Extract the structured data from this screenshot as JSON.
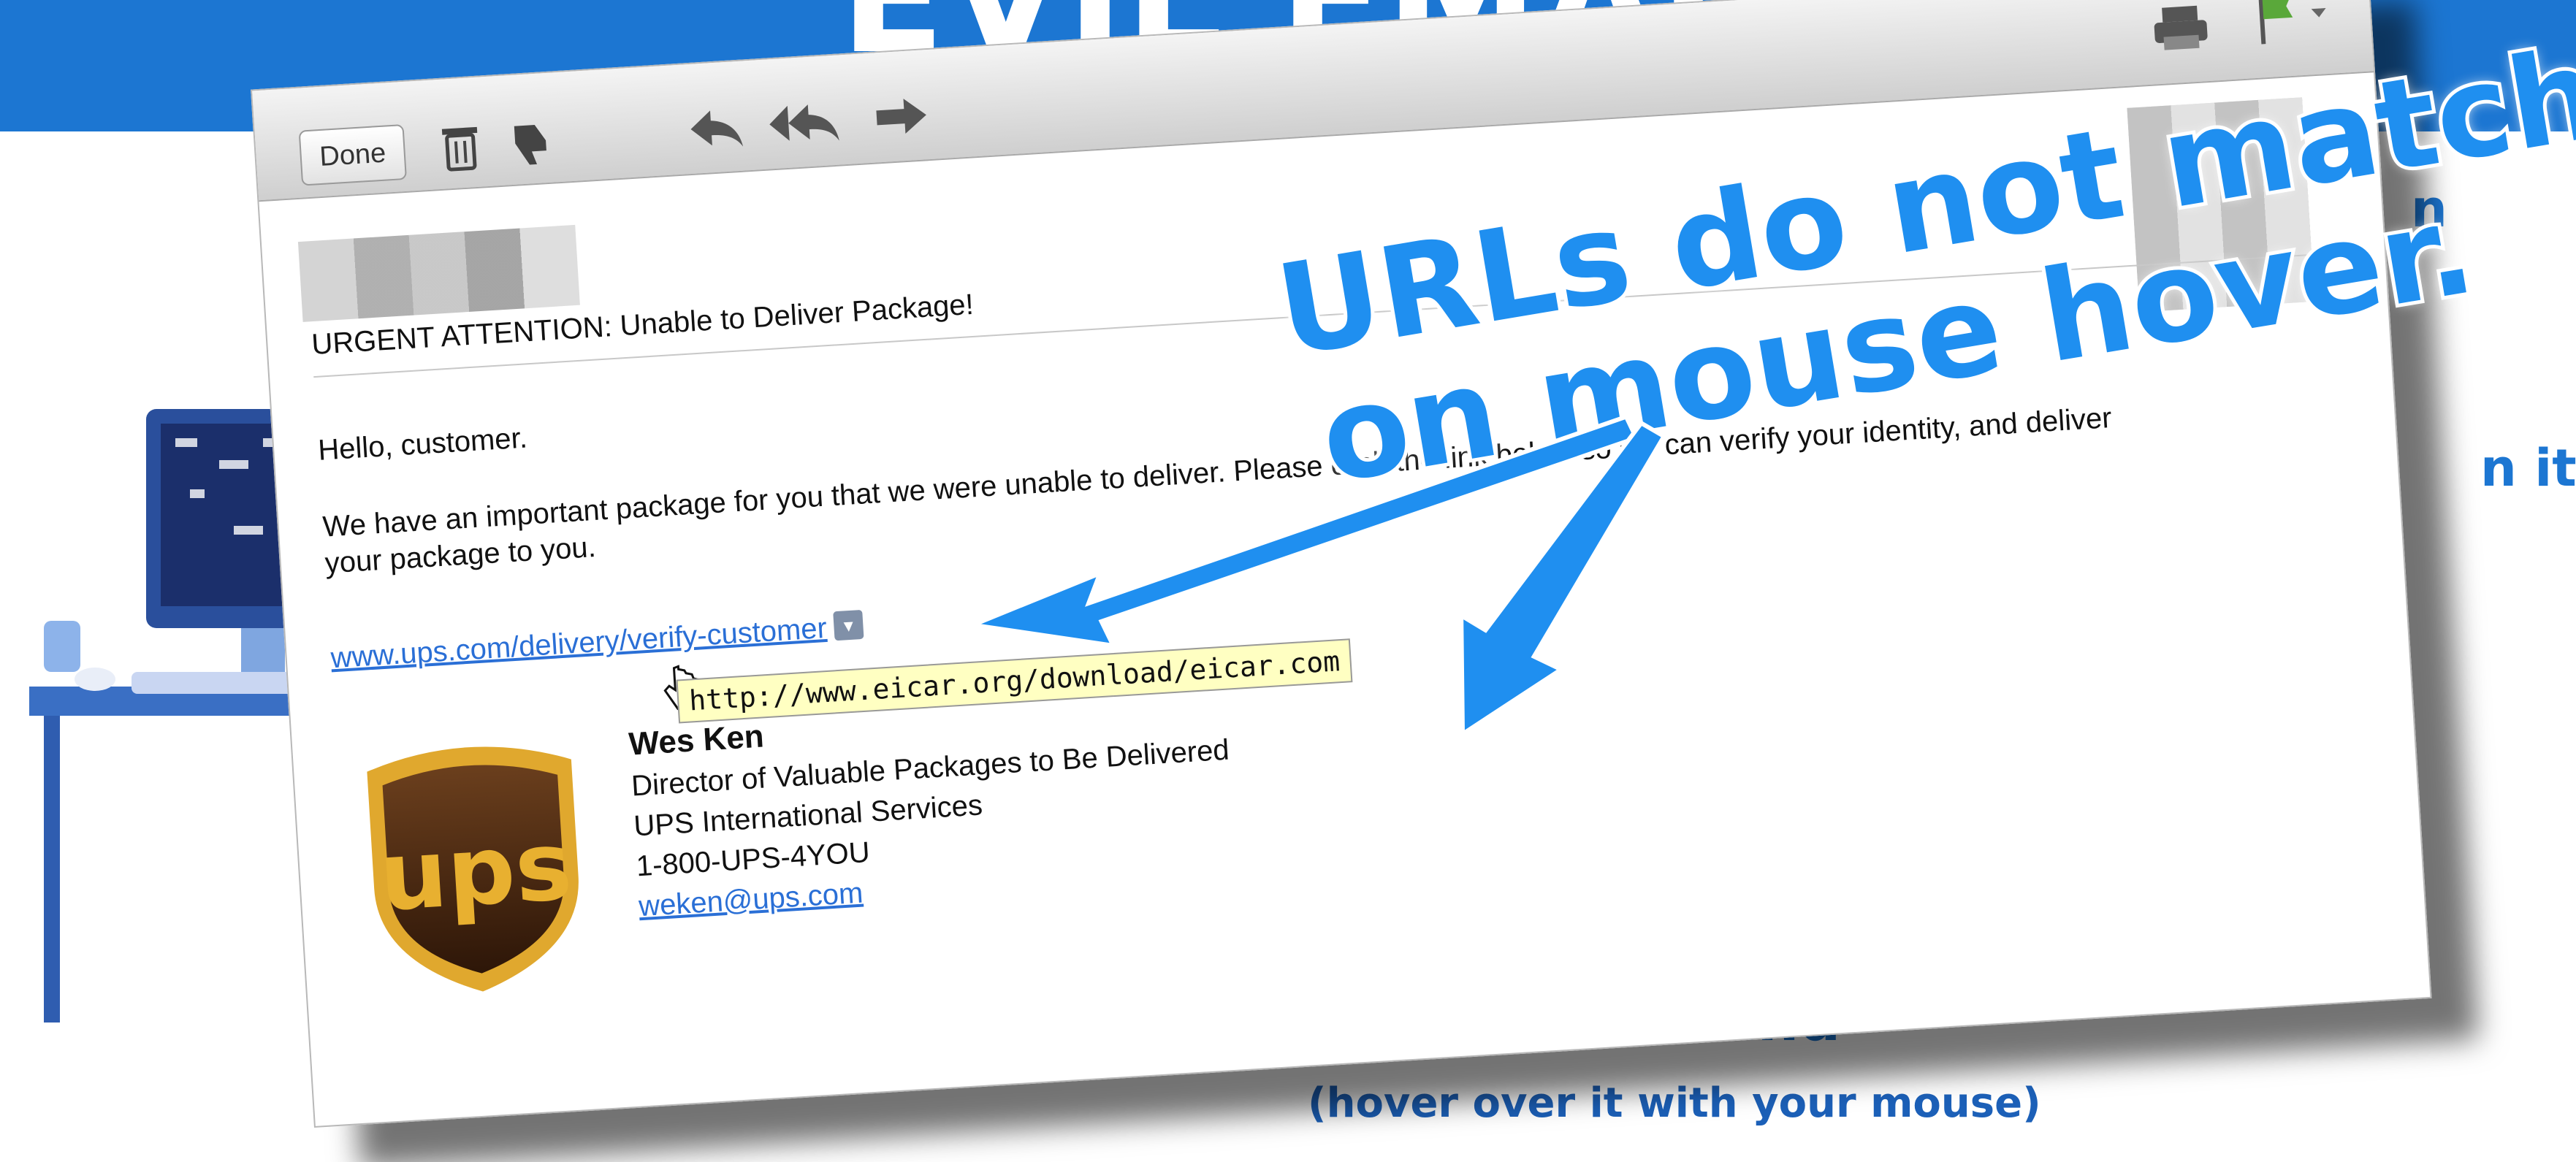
{
  "banner": {
    "title": "EVIL EMAIL"
  },
  "side_fragments": {
    "right_top": "n",
    "right_middle": "n it"
  },
  "footer": {
    "peek_text": "around",
    "hover_hint": "(hover over it with your mouse)"
  },
  "email": {
    "toolbar": {
      "done_label": "Done",
      "icons": [
        "trash-icon",
        "thumbs-down-icon",
        "reply-icon",
        "reply-all-icon",
        "forward-icon",
        "print-icon",
        "flag-icon"
      ]
    },
    "subject": "URGENT ATTENTION: Unable to Deliver Package!",
    "greeting": "Hello, customer.",
    "body_line_1": "We have an important package for you that we were unable to deliver. Please click the link below so we can verify your identity, and deliver",
    "body_line_2": "your package to you.",
    "link_text": "www.ups.com/delivery/verify-customer",
    "tooltip_url": "http://www.eicar.org/download/eicar.com",
    "signature": {
      "name": "Wes Ken",
      "title": "Director of Valuable Packages to Be Delivered",
      "company": "UPS International Services",
      "phone": "1-800-UPS-4YOU",
      "email": "weken@ups.com"
    },
    "logo_text": "ups"
  },
  "callout": {
    "line_1": "URLs do not match",
    "line_2": "on mouse hover."
  },
  "colors": {
    "brand_blue": "#1c76d2",
    "callout_blue": "#1f8ff0",
    "link_blue": "#2a6fd6",
    "tooltip_bg": "#ffffc2"
  }
}
